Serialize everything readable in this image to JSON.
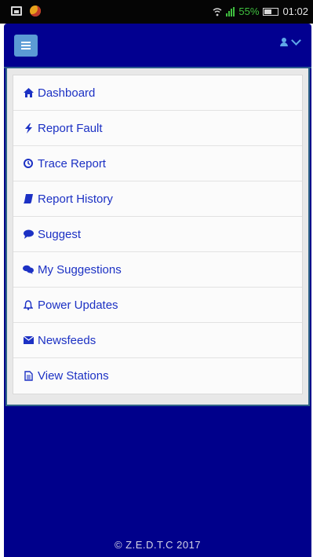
{
  "status_bar": {
    "battery_percent": "55%",
    "time": "01:02",
    "colors": {
      "battery_text": "#3fbf3f",
      "signal": "#3fbf3f"
    }
  },
  "header": {
    "menu_icon": "hamburger-icon",
    "user_icon": "user-icon",
    "dropdown_icon": "chevron-down-icon"
  },
  "menu": {
    "items": [
      {
        "label": "Dashboard",
        "icon": "home-icon"
      },
      {
        "label": "Report Fault",
        "icon": "bolt-icon"
      },
      {
        "label": "Trace Report",
        "icon": "clock-icon"
      },
      {
        "label": "Report History",
        "icon": "book-icon"
      },
      {
        "label": "Suggest",
        "icon": "comment-icon"
      },
      {
        "label": "My Suggestions",
        "icon": "comments-icon"
      },
      {
        "label": "Power Updates",
        "icon": "bell-icon"
      },
      {
        "label": "Newsfeeds",
        "icon": "envelope-icon"
      },
      {
        "label": "View Stations",
        "icon": "file-icon"
      }
    ]
  },
  "footer": {
    "text": "© Z.E.D.T.C  2017"
  },
  "colors": {
    "frame_background": "#00008b",
    "menu_text": "#1c31c4",
    "menu_button": "#5b9bd5"
  }
}
